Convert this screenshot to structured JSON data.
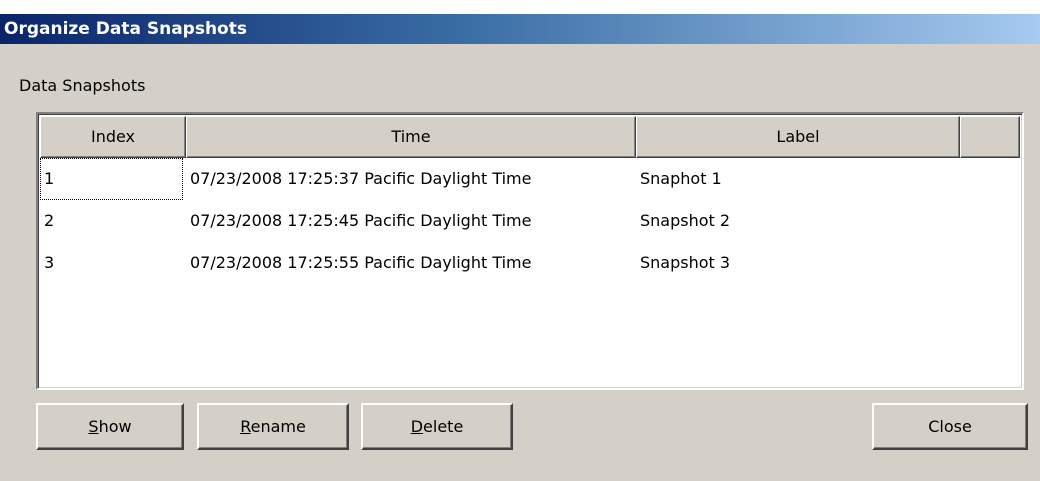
{
  "window": {
    "title": "Organize Data Snapshots"
  },
  "group_label": "Data Snapshots",
  "table": {
    "columns": [
      "Index",
      "Time",
      "Label"
    ],
    "rows": [
      {
        "index": "1",
        "time": "07/23/2008 17:25:37 Pacific Daylight Time",
        "label": "Snaphot 1"
      },
      {
        "index": "2",
        "time": "07/23/2008 17:25:45 Pacific Daylight Time",
        "label": "Snapshot 2"
      },
      {
        "index": "3",
        "time": "07/23/2008 17:25:55 Pacific Daylight Time",
        "label": "Snapshot 3"
      }
    ]
  },
  "buttons": {
    "show": {
      "mnemonic": "S",
      "rest": "how"
    },
    "rename": {
      "mnemonic": "R",
      "rest": "ename"
    },
    "delete": {
      "mnemonic": "D",
      "rest": "elete"
    },
    "close": "Close"
  },
  "colors": {
    "face": "#d4d0c8",
    "titlebar_start": "#0a246a",
    "titlebar_end": "#a6caf0"
  }
}
